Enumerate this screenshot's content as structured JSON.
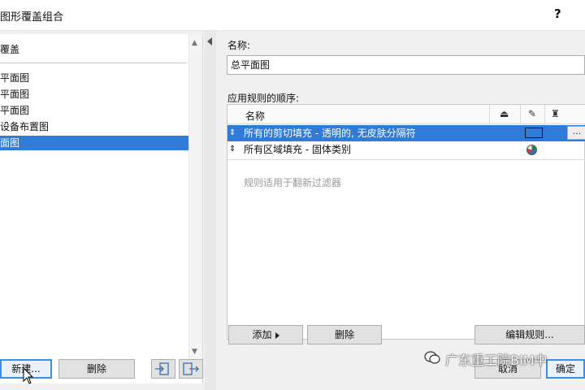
{
  "window": {
    "title": "图形覆盖组合",
    "help": "?"
  },
  "left": {
    "header": "覆盖",
    "items": [
      {
        "label": "平面图"
      },
      {
        "label": "平面图"
      },
      {
        "label": "平面图"
      },
      {
        "label": "设备布置图"
      },
      {
        "label": "面图",
        "selected": true
      }
    ],
    "buttons": {
      "new": "新建...",
      "delete": "删除"
    }
  },
  "right": {
    "name_label": "名称:",
    "name_value": "总平面图",
    "rules_label": "应用规则的顺序:",
    "columns": {
      "name": "名称"
    },
    "rules": [
      {
        "text": "所有的剪切填充 - 透明的, 无皮肤分隔符",
        "selected": true,
        "more": "..."
      },
      {
        "text": "所有区域填充 - 固体类别"
      }
    ],
    "placeholder": "规则适用于翻新过滤器",
    "buttons": {
      "add": "添加",
      "delete": "删除",
      "edit": "编辑规则..."
    }
  },
  "footer": {
    "cancel": "取消",
    "ok": "确定"
  },
  "watermark": "广东重工院BIM中",
  "colors": {
    "selection": "#2f7bd8",
    "dialog_bg": "#f0f0f0"
  }
}
